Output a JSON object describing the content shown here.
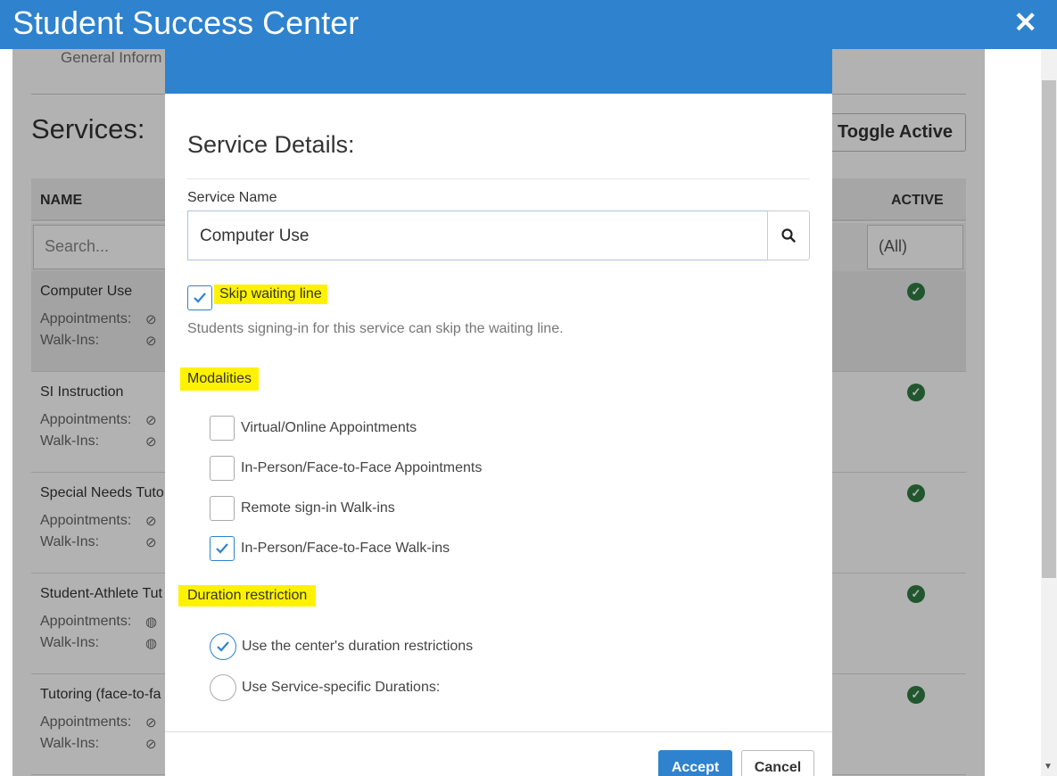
{
  "app": {
    "title": "Student Success Center"
  },
  "background": {
    "tab_label": "General Inform",
    "services_title": "Services:",
    "toggle_active_label": "Toggle Active",
    "columns": {
      "name": "NAME",
      "active": "ACTIVE"
    },
    "search_placeholder": "Search...",
    "active_filter": "(All)",
    "rows": [
      {
        "name": "Computer Use",
        "appointments": "Appointments:",
        "walkins": "Walk-Ins:",
        "appt_icon": "eye-slash-icon",
        "walk_icon": "eye-slash-icon"
      },
      {
        "name": "SI Instruction",
        "appointments": "Appointments:",
        "walkins": "Walk-Ins:",
        "appt_icon": "eye-slash-icon",
        "walk_icon": "eye-slash-icon"
      },
      {
        "name": "Special Needs Tuto",
        "appointments": "Appointments:",
        "walkins": "Walk-Ins:",
        "appt_icon": "eye-slash-icon",
        "walk_icon": "eye-slash-icon"
      },
      {
        "name": "Student-Athlete Tut",
        "appointments": "Appointments:",
        "walkins": "Walk-Ins:",
        "appt_icon": "globe-icon",
        "walk_icon": "globe-icon"
      },
      {
        "name": "Tutoring (face-to-fa",
        "appointments": "Appointments:",
        "walkins": "Walk-Ins:",
        "appt_icon": "eye-slash-icon",
        "walk_icon": "eye-slash-icon"
      }
    ]
  },
  "modal": {
    "title": "Service Details:",
    "service_name_label": "Service Name",
    "service_name_value": "Computer Use",
    "skip_waiting_label": "Skip waiting line",
    "skip_waiting_checked": true,
    "skip_help": "Students signing-in for this service can skip the waiting line.",
    "modalities_label": "Modalities",
    "modalities": [
      {
        "label": "Virtual/Online Appointments",
        "checked": false
      },
      {
        "label": "In-Person/Face-to-Face Appointments",
        "checked": false
      },
      {
        "label": "Remote sign-in Walk-ins",
        "checked": false
      },
      {
        "label": "In-Person/Face-to-Face Walk-ins",
        "checked": true
      }
    ],
    "duration_label": "Duration restriction",
    "duration_options": [
      {
        "label": "Use the center's duration restrictions",
        "selected": true
      },
      {
        "label": "Use Service-specific Durations:",
        "selected": false
      }
    ],
    "accept_label": "Accept",
    "cancel_label": "Cancel"
  },
  "colors": {
    "primary": "#2f82cd",
    "highlight": "#fff200",
    "active_green": "#2f7d43"
  }
}
